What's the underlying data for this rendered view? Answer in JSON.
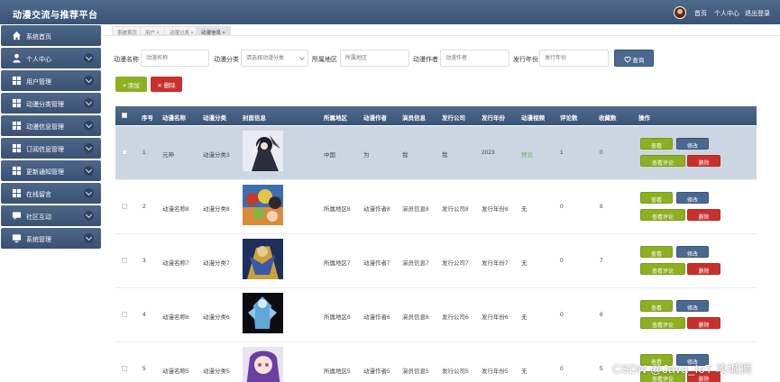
{
  "app": {
    "title": "动漫交流与推荐平台"
  },
  "topnav": {
    "home": "首页",
    "profile": "个人中心",
    "logout": "退出登录"
  },
  "sidebar": {
    "items": [
      {
        "label": "系统首页",
        "icon": "home-icon",
        "expandable": false
      },
      {
        "label": "个人中心",
        "icon": "user-icon",
        "expandable": true
      },
      {
        "label": "用户管理",
        "icon": "grid-icon",
        "expandable": true
      },
      {
        "label": "动漫分类管理",
        "icon": "grid-icon",
        "expandable": true
      },
      {
        "label": "动漫信息管理",
        "icon": "grid-icon",
        "expandable": true
      },
      {
        "label": "订阅信息管理",
        "icon": "grid-icon",
        "expandable": true
      },
      {
        "label": "更新通知管理",
        "icon": "grid-icon",
        "expandable": true
      },
      {
        "label": "在线留言",
        "icon": "grid-icon",
        "expandable": true
      },
      {
        "label": "社区互动",
        "icon": "chat-icon",
        "expandable": true
      },
      {
        "label": "系统管理",
        "icon": "monitor-icon",
        "expandable": true
      }
    ]
  },
  "tabs": [
    {
      "label": "系统首页",
      "active": false
    },
    {
      "label": "用户 ×",
      "active": false
    },
    {
      "label": "动漫分类 ×",
      "active": false
    },
    {
      "label": "动漫信息 ×",
      "active": true
    }
  ],
  "search": {
    "name_label": "动漫名称",
    "name_placeholder": "动漫名称",
    "category_label": "动漫分类",
    "category_placeholder": "请选择动漫分类",
    "region_label": "所属地区",
    "region_placeholder": "所属地区",
    "author_label": "动漫作者",
    "author_placeholder": "动漫作者",
    "year_label": "发行年份",
    "year_placeholder": "发行年份",
    "query_button": "查询"
  },
  "actions": {
    "add": "添加",
    "delete": "删除"
  },
  "table": {
    "headers": {
      "index": "序号",
      "name": "动漫名称",
      "category": "动漫分类",
      "cover": "封面信息",
      "region": "所属地区",
      "author": "动漫作者",
      "cast": "演员信息",
      "company": "发行公司",
      "year": "发行年份",
      "video": "动漫视频",
      "comments": "评论数",
      "favorites": "收藏数",
      "ops": "操作"
    },
    "row_buttons": {
      "view": "查看",
      "edit": "修改",
      "view_comments": "查看评论",
      "delete": "删除"
    },
    "rows": [
      {
        "index": "1",
        "name": "元神",
        "category": "动漫分类3",
        "region": "中国",
        "author": "为",
        "cast": "我",
        "company": "我",
        "year": "2023",
        "video": "预览",
        "comments": "1",
        "favorites": "0",
        "selected": true
      },
      {
        "index": "2",
        "name": "动漫名称8",
        "category": "动漫分类8",
        "region": "所属地区8",
        "author": "动漫作者8",
        "cast": "演员信息8",
        "company": "发行公司8",
        "year": "发行年份8",
        "video": "无",
        "comments": "0",
        "favorites": "8",
        "selected": false
      },
      {
        "index": "3",
        "name": "动漫名称7",
        "category": "动漫分类7",
        "region": "所属地区7",
        "author": "动漫作者7",
        "cast": "演员信息7",
        "company": "发行公司7",
        "year": "发行年份7",
        "video": "无",
        "comments": "0",
        "favorites": "7",
        "selected": false
      },
      {
        "index": "4",
        "name": "动漫名称6",
        "category": "动漫分类6",
        "region": "所属地区6",
        "author": "动漫作者6",
        "cast": "演员信息6",
        "company": "发行公司6",
        "year": "发行年份6",
        "video": "无",
        "comments": "0",
        "favorites": "6",
        "selected": false
      },
      {
        "index": "5",
        "name": "动漫名称5",
        "category": "动漫分类5",
        "region": "所属地区5",
        "author": "动漫作者5",
        "cast": "演员信息5",
        "company": "发行公司5",
        "year": "发行年份5",
        "video": "无",
        "comments": "0",
        "favorites": "5",
        "selected": false
      }
    ]
  },
  "colors": {
    "header_blue": "#3f5779",
    "accent_green": "#8db022",
    "danger_red": "#c9302c",
    "selected_row": "#ccd6e3"
  },
  "watermark": "CSDN @Java_IoT 攻城狮"
}
